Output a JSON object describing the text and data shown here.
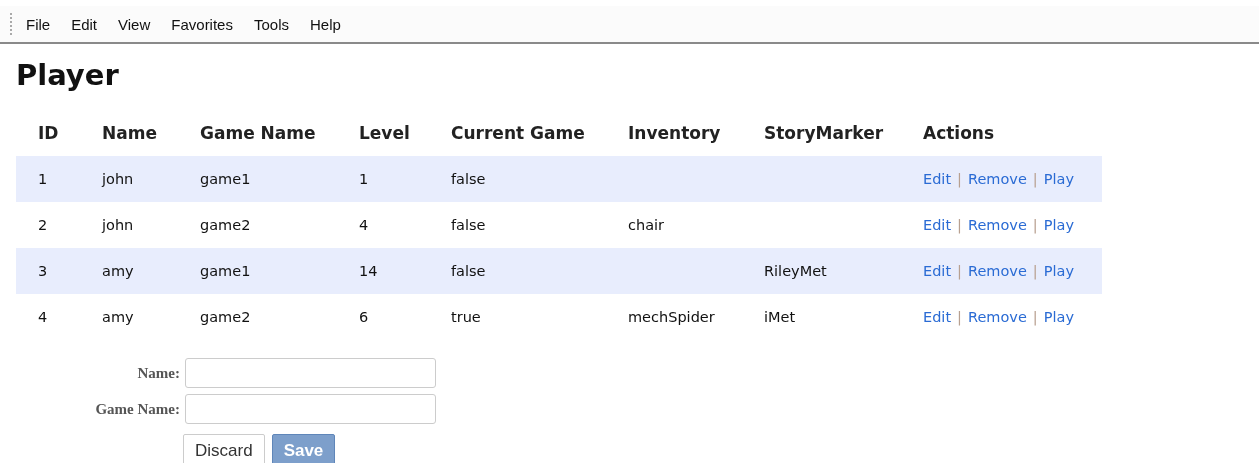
{
  "menu_bar": {
    "items": [
      "File",
      "Edit",
      "View",
      "Favorites",
      "Tools",
      "Help"
    ]
  },
  "page": {
    "title": "Player"
  },
  "table": {
    "columns": [
      "ID",
      "Name",
      "Game Name",
      "Level",
      "Current Game",
      "Inventory",
      "StoryMarker",
      "Actions"
    ],
    "rows": [
      {
        "cells": [
          "1",
          "john",
          "game1",
          "1",
          "false",
          "",
          ""
        ],
        "actions": [
          "Edit",
          "Remove",
          "Play"
        ],
        "separators": [
          "|",
          "|"
        ]
      },
      {
        "cells": [
          "2",
          "john",
          "game2",
          "4",
          "false",
          "chair",
          ""
        ],
        "actions": [
          "Edit",
          "Remove",
          "Play"
        ],
        "separators": [
          "|",
          "|"
        ]
      },
      {
        "cells": [
          "3",
          "amy",
          "game1",
          "14",
          "false",
          "",
          "RileyMet"
        ],
        "actions": [
          "Edit",
          "Remove",
          "Play"
        ],
        "separators": [
          "|",
          "|"
        ]
      },
      {
        "cells": [
          "4",
          "amy",
          "game2",
          "6",
          "true",
          "mechSpider",
          "iMet"
        ],
        "actions": [
          "Edit",
          "Remove",
          "Play"
        ],
        "separators": [
          "|",
          "|"
        ]
      }
    ]
  },
  "form": {
    "fields": [
      {
        "label": "Name:"
      },
      {
        "label": "Game Name:"
      }
    ],
    "buttons": [
      {
        "label": "Discard",
        "kind": "secondary"
      },
      {
        "label": "Save",
        "kind": "primary"
      }
    ]
  }
}
